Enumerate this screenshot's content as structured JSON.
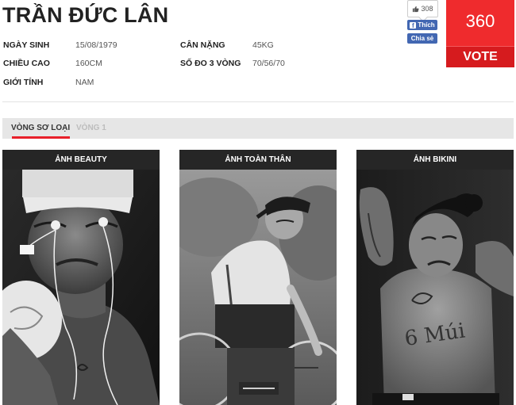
{
  "contestant": {
    "name": "TRẦN ĐỨC LÂN"
  },
  "info": {
    "birth_label": "NGÀY SINH",
    "birth_value": "15/08/1979",
    "weight_label": "CÂN NẶNG",
    "weight_value": "45KG",
    "height_label": "CHIỀU CAO",
    "height_value": "160CM",
    "measure_label": "SỐ ĐO 3 VÒNG",
    "measure_value": "70/56/70",
    "gender_label": "GIỚI TÍNH",
    "gender_value": "NAM"
  },
  "social": {
    "like_count": "308",
    "like_label": "Thích",
    "share_label": "Chia sẻ"
  },
  "vote": {
    "count": "360",
    "label": "VOTE"
  },
  "tabs": [
    {
      "label": "VÒNG SƠ LOẠI"
    },
    {
      "label": "VÒNG 1"
    }
  ],
  "photos": [
    {
      "title": "ẢNH BEAUTY"
    },
    {
      "title": "ẢNH TOÀN THÂN"
    },
    {
      "title": "ẢNH BIKINI",
      "body_text": "6 Múi"
    }
  ],
  "colors": {
    "accent": "#ef2b2d",
    "facebook": "#4267b2",
    "card_bg": "#1e1e1e"
  }
}
